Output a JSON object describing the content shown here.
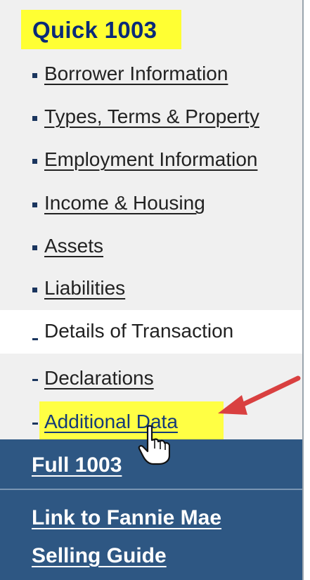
{
  "header": {
    "title": "Quick 1003"
  },
  "nav": {
    "items": [
      {
        "label": "Borrower Information"
      },
      {
        "label": "Types, Terms & Property"
      },
      {
        "label": "Employment Information"
      },
      {
        "label": "Income & Housing"
      },
      {
        "label": "Assets"
      },
      {
        "label": "Liabilities"
      },
      {
        "label": "Details of Transaction",
        "state": "active"
      },
      {
        "label": "Declarations"
      },
      {
        "label": "Additional Data",
        "state": "hovered"
      }
    ]
  },
  "footer": {
    "full_link": "Full 1003",
    "guide_link_line1": "Link to Fannie Mae",
    "guide_link_line2": "Selling Guide"
  },
  "colors": {
    "title": "#0a2a78",
    "highlight": "#ffff33",
    "footer_bg": "#2e5783",
    "arrow": "#e53b3b"
  },
  "icons": [
    "arrow-annotation-icon",
    "hand-cursor-icon"
  ]
}
